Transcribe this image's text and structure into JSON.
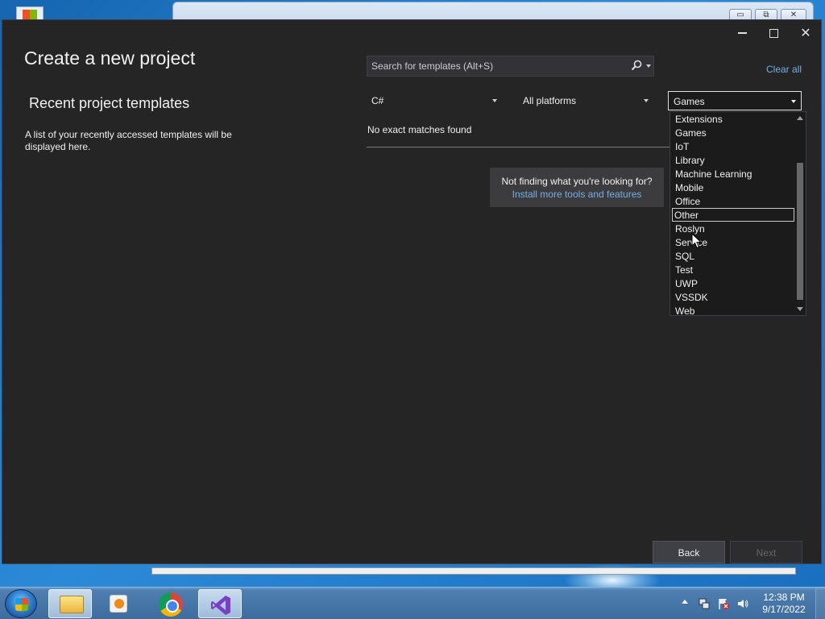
{
  "dialog": {
    "title": "Create a new project",
    "recent_heading": "Recent project templates",
    "recent_description": "A list of your recently accessed templates will be displayed here.",
    "search_placeholder": "Search for templates (Alt+S)",
    "clear_all": "Clear all",
    "filters": {
      "language": "C#",
      "platform": "All platforms",
      "project_type": "Games"
    },
    "no_results": "No exact matches found",
    "hint_text": "Not finding what you're looking for?",
    "hint_link": "Install more tools and features",
    "project_type_options": [
      "Extensions",
      "Games",
      "IoT",
      "Library",
      "Machine Learning",
      "Mobile",
      "Office",
      "Other",
      "Roslyn",
      "Service",
      "SQL",
      "Test",
      "UWP",
      "VSSDK",
      "Web"
    ],
    "hovered_option": "Other",
    "back_label": "Back",
    "next_label": "Next"
  },
  "taskbar": {
    "time": "12:38 PM",
    "date": "9/17/2022",
    "apps": [
      "explorer-icon",
      "media-player-icon",
      "chrome-icon",
      "visual-studio-icon"
    ]
  }
}
